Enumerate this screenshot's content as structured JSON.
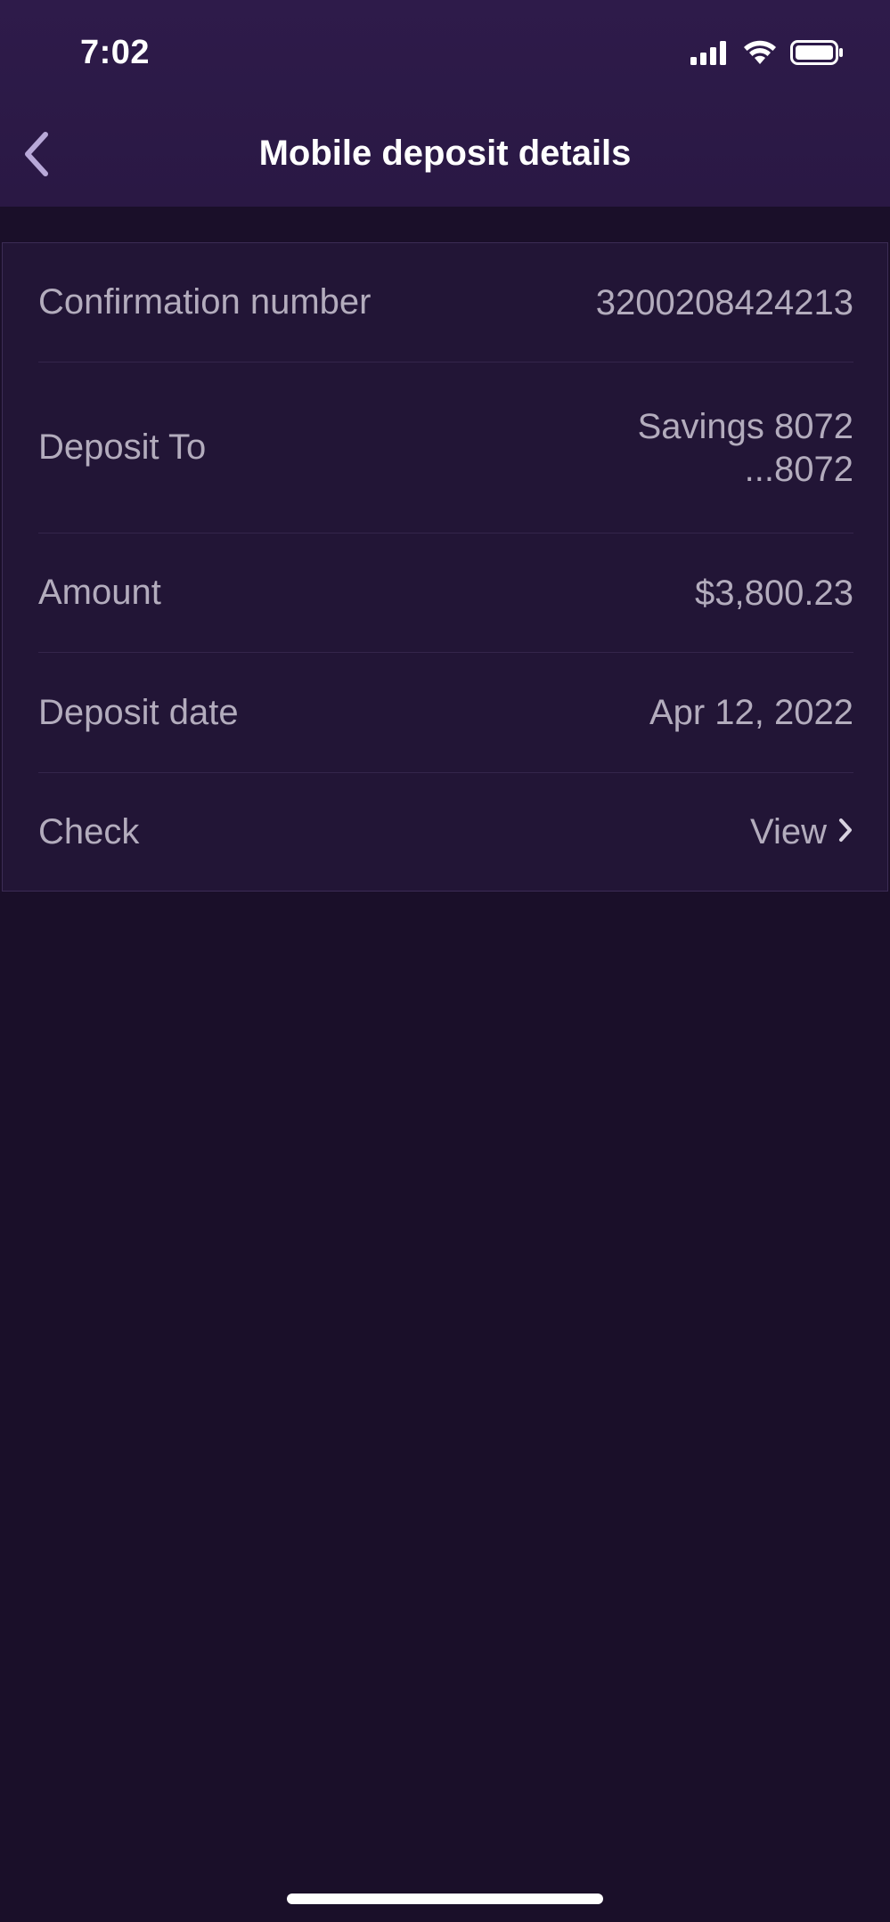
{
  "status_bar": {
    "time": "7:02",
    "icons": [
      "cellular-signal-icon",
      "wifi-icon",
      "battery-icon"
    ]
  },
  "nav": {
    "back_icon": "chevron-left-icon",
    "title": "Mobile deposit details"
  },
  "details": {
    "confirmation": {
      "label": "Confirmation number",
      "value": "3200208424213"
    },
    "deposit_to": {
      "label": "Deposit To",
      "account_name": "Savings 8072",
      "account_mask": "...8072"
    },
    "amount": {
      "label": "Amount",
      "value": "$3,800.23"
    },
    "deposit_date": {
      "label": "Deposit date",
      "value": "Apr 12, 2022"
    },
    "check": {
      "label": "Check",
      "link_label": "View",
      "link_icon": "chevron-right-icon"
    }
  },
  "colors": {
    "background": "#1a0f29",
    "header": "#2e1b4a",
    "card": "#221536",
    "text_muted": "#b3acbd",
    "text_primary": "#ffffff"
  }
}
